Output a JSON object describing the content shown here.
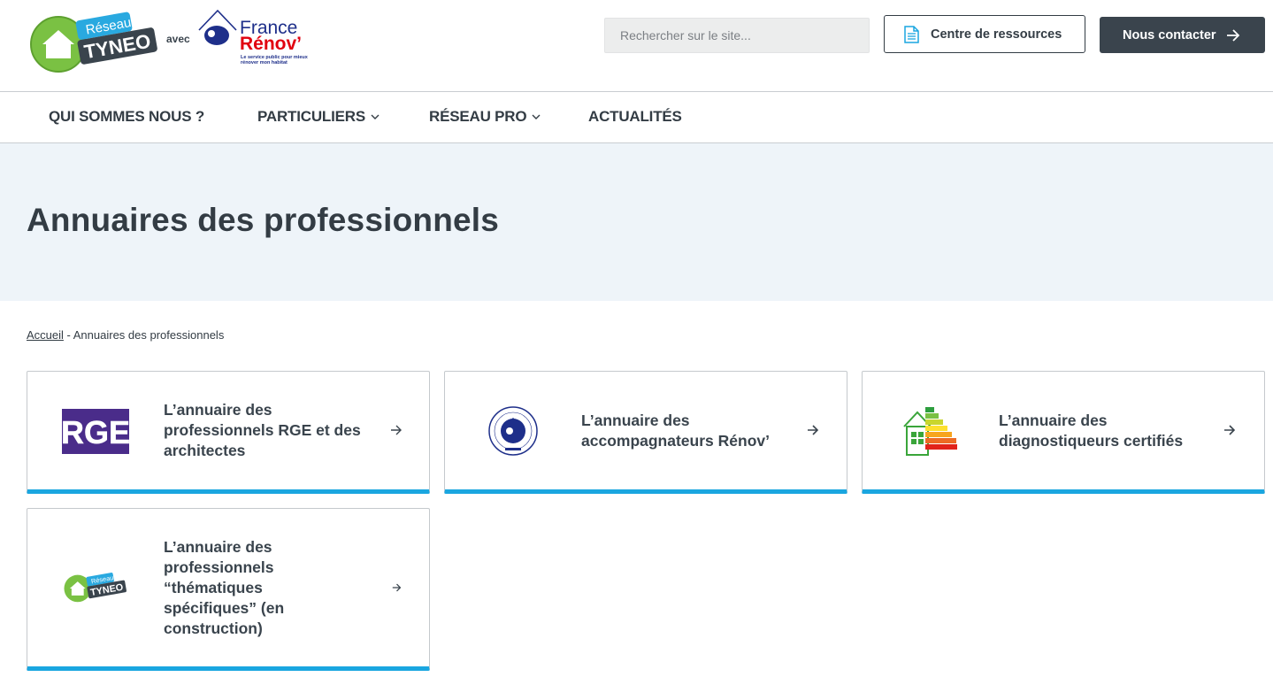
{
  "header": {
    "logo_tyneo_top": "Réseau",
    "logo_tyneo_bottom": "TYNEO",
    "avec": "avec",
    "fr_line1": "France",
    "fr_line2": "Rénov’",
    "fr_tagline": "Le service public pour mieux rénover mon habitat",
    "search_placeholder": "Rechercher sur le site...",
    "resources_label": "Centre de ressources",
    "contact_label": "Nous contacter"
  },
  "nav": {
    "items": [
      {
        "label": "QUI SOMMES NOUS ?",
        "dropdown": false
      },
      {
        "label": "PARTICULIERS",
        "dropdown": true
      },
      {
        "label": "RÉSEAU PRO",
        "dropdown": true
      },
      {
        "label": "ACTUALITÉS",
        "dropdown": false
      }
    ]
  },
  "hero": {
    "title": "Annuaires des professionnels"
  },
  "breadcrumb": {
    "home": "Accueil",
    "separator": " - ",
    "current": "Annuaires des professionnels"
  },
  "cards": [
    {
      "title_lines": [
        "L’annuaire des",
        "professionnels RGE et des",
        "architectes"
      ],
      "icon": "rge-logo",
      "logo_text": "RGE"
    },
    {
      "title_lines": [
        "L’annuaire des",
        "accompagnateurs Rénov’"
      ],
      "icon": "mon-accompagnateur-renov-badge"
    },
    {
      "title_lines": [
        "L’annuaire des",
        "diagnostiqueurs certifiés"
      ],
      "icon": "energy-label-house-icon"
    },
    {
      "title_lines": [
        "L’annuaire des",
        "professionnels",
        "“thématiques",
        "spécifiques” (en",
        "construction)"
      ],
      "icon": "reseau-tyneo-logo",
      "logo_top": "Réseau",
      "logo_bottom": "TYNEO"
    }
  ],
  "colors": {
    "accent": "#1aa6e0",
    "dark": "#3a444d",
    "hero_bg": "#eef4f9",
    "rge_purple": "#4a2c8a",
    "tyneo_green": "#7ac143"
  }
}
